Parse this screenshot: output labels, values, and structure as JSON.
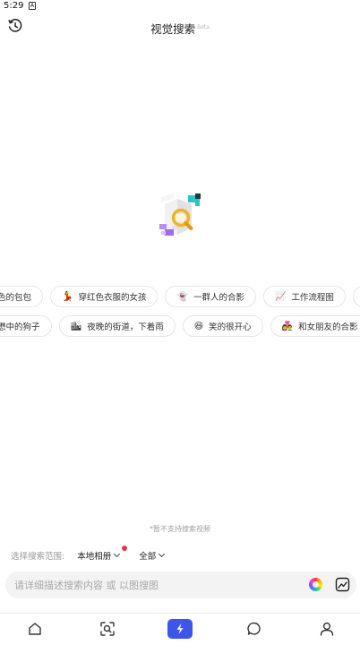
{
  "status_bar": {
    "time": "5:29",
    "app_indicator": "A"
  },
  "header": {
    "title": "视觉搜索",
    "badge": "Beta"
  },
  "chips_row1": [
    {
      "emoji": "",
      "label": "色的包包"
    },
    {
      "emoji": "💃",
      "label": "穿红色衣服的女孩"
    },
    {
      "emoji": "👻",
      "label": "一群人的合影"
    },
    {
      "emoji": "📈",
      "label": "工作流程图"
    },
    {
      "emoji": "⛵",
      "label": ""
    }
  ],
  "chips_row2": [
    {
      "emoji": "",
      "label": "懋中的狗子"
    },
    {
      "emoji": "🏙",
      "label": "夜晚的街道，下着雨"
    },
    {
      "emoji": "😆",
      "label": "笑的很开心"
    },
    {
      "emoji": "👩‍❤️‍👨",
      "label": "和女朋友的合影"
    }
  ],
  "hint": "*暂不支持搜索视频",
  "scope": {
    "label": "选择搜索范围:",
    "source": "本地相册",
    "type": "全部"
  },
  "search": {
    "value": "",
    "placeholder": "请详细描述搜索内容 或 以图搜图"
  },
  "tabs": [
    {
      "name": "home-icon"
    },
    {
      "name": "scan-search-icon"
    },
    {
      "name": "sparkle-icon"
    },
    {
      "name": "chat-icon"
    },
    {
      "name": "profile-icon"
    }
  ],
  "colors": {
    "accent": "#3d56e8",
    "badge_dot": "#e53935"
  }
}
